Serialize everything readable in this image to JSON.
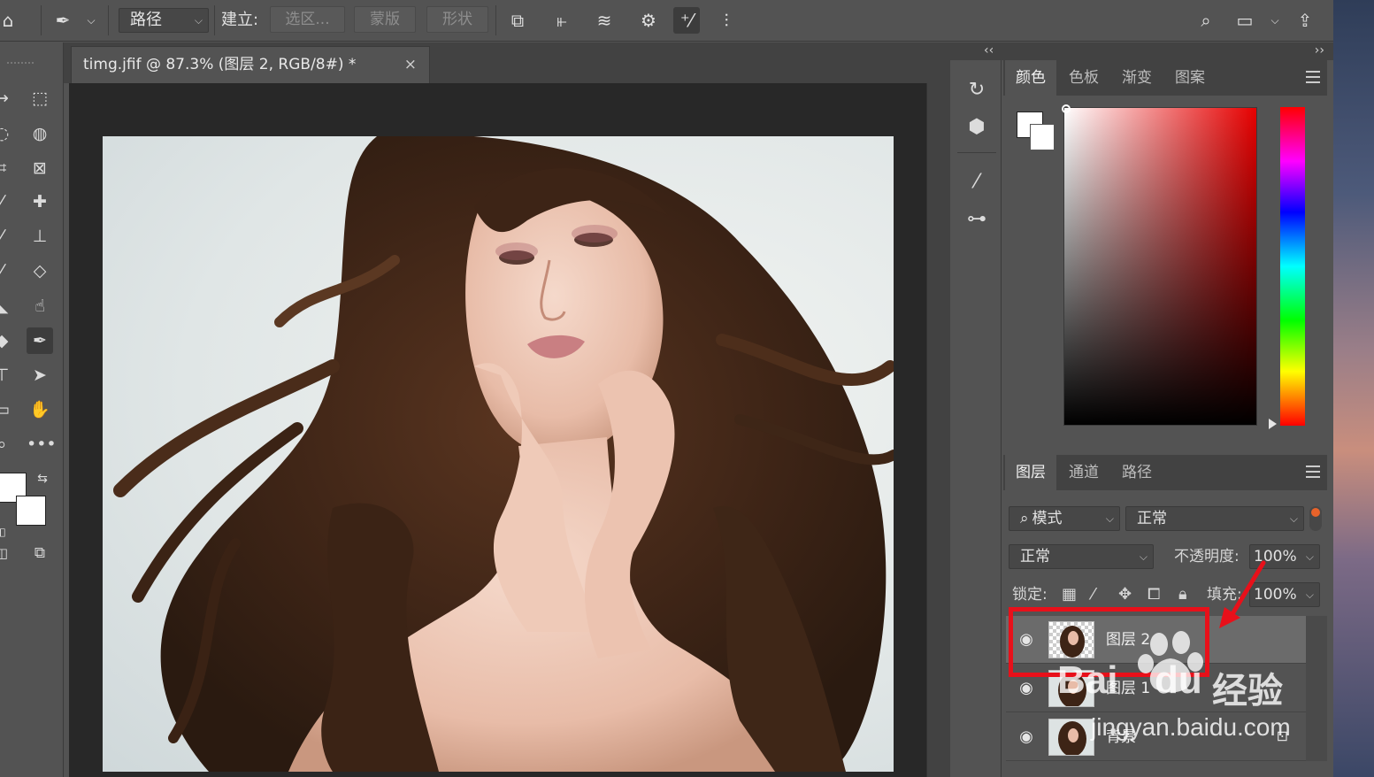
{
  "options_bar": {
    "mode_select": "路径",
    "make_label": "建立:",
    "btn_selection": "选区...",
    "btn_mask": "蒙版",
    "btn_shape": "形状"
  },
  "document": {
    "tab_title": "timg.jfif @ 87.3% (图层 2, RGB/8#) *",
    "close": "×"
  },
  "dock": {
    "collapse_left": "‹‹",
    "collapse_right": "››"
  },
  "color_panel": {
    "tabs": [
      "颜色",
      "色板",
      "渐变",
      "图案"
    ]
  },
  "layers_panel": {
    "tabs": [
      "图层",
      "通道",
      "路径"
    ],
    "filter_label": "模式",
    "filter_value": "正常",
    "blend_mode": "正常",
    "opacity_label": "不透明度:",
    "opacity_value": "100%",
    "lock_label": "锁定:",
    "fill_label": "填充:",
    "fill_value": "100%",
    "layers": [
      {
        "name": "图层 2"
      },
      {
        "name": "图层 1"
      },
      {
        "name": "背景"
      }
    ]
  },
  "watermark": {
    "brand": "Bai",
    "brand2": "du",
    "product": "经验",
    "url": "jingyan.baidu.com"
  },
  "colors": {
    "highlight": "#e8101a",
    "panel_bg": "#535353",
    "canvas_bg": "#282828"
  }
}
